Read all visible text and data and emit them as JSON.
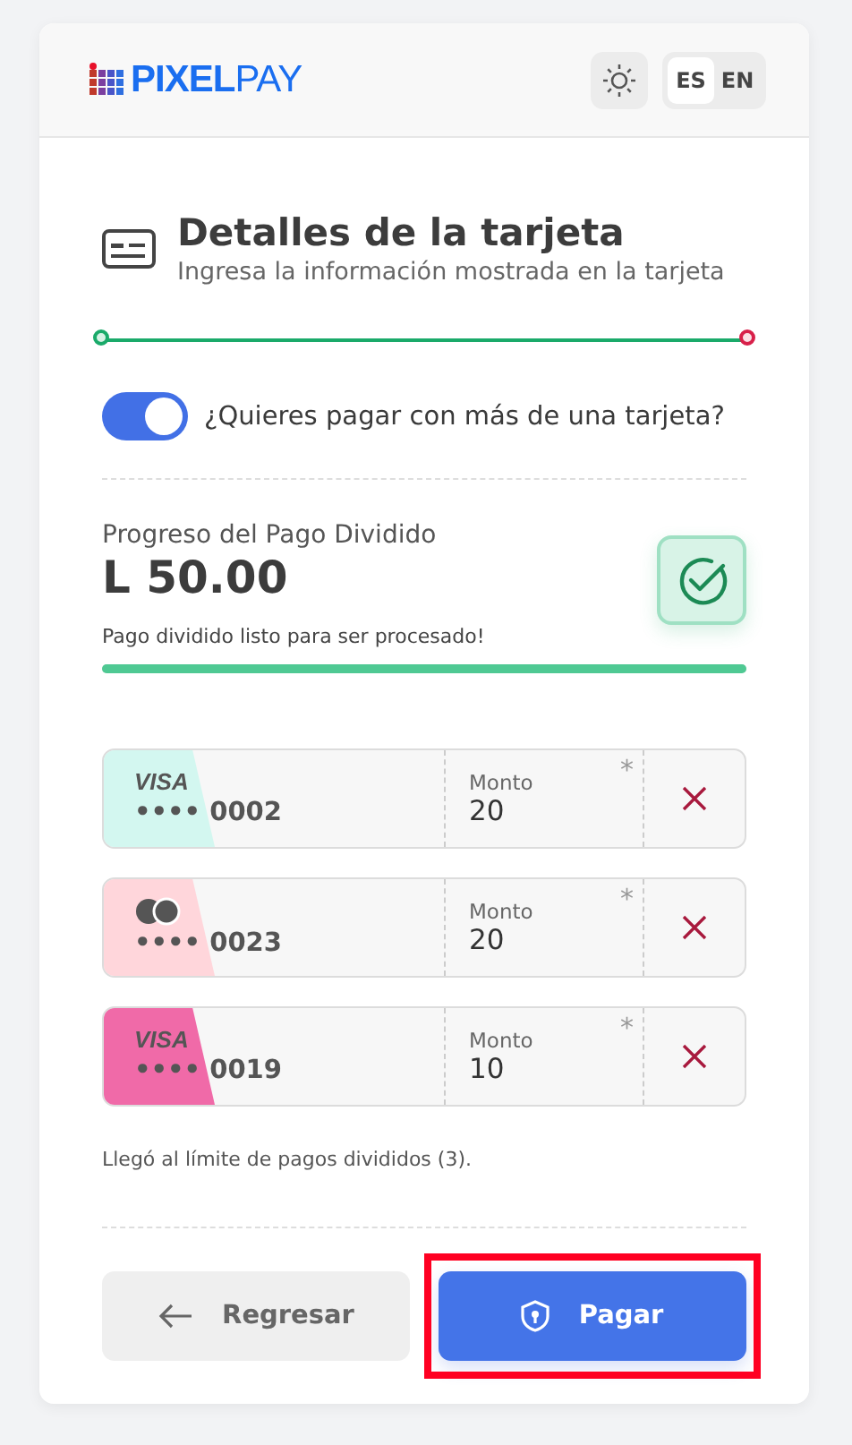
{
  "header": {
    "logo": {
      "bold": "PIXEL",
      "light": "PAY"
    },
    "languages": [
      {
        "label": "ES",
        "selected": true
      },
      {
        "label": "EN",
        "selected": false
      }
    ]
  },
  "section": {
    "title": "Detalles de la tarjeta",
    "subtitle": "Ingresa la información mostrada en la tarjeta"
  },
  "stepper": {
    "level": 1
  },
  "split_toggle": {
    "label": "¿Quieres pagar con más de una tarjeta?",
    "on": true
  },
  "progress": {
    "label": "Progreso del Pago Dividido",
    "amount": "L 50.00",
    "message": "Pago dividido listo para ser procesado!",
    "level": 1,
    "complete": true
  },
  "cards": [
    {
      "kind": "visa",
      "brand": "VISA",
      "number": "•••• 0002",
      "color": "#d3f7f0",
      "amount_label": "Monto",
      "required": "*",
      "amount": "20"
    },
    {
      "kind": "mastercard",
      "number": "•••• 0023",
      "color": "#ffd6db",
      "amount_label": "Monto",
      "required": "*",
      "amount": "20"
    },
    {
      "kind": "visa",
      "brand": "VISA",
      "number": "•••• 0019",
      "color": "#f06aa8",
      "amount_label": "Monto",
      "required": "*",
      "amount": "10"
    }
  ],
  "limit_note": "Llegó al límite de pagos divididos (3).",
  "buttons": [
    {
      "kind": "back",
      "label": "Regresar",
      "highlighted": false
    },
    {
      "kind": "pay",
      "label": "Pagar",
      "highlighted": true
    }
  ]
}
